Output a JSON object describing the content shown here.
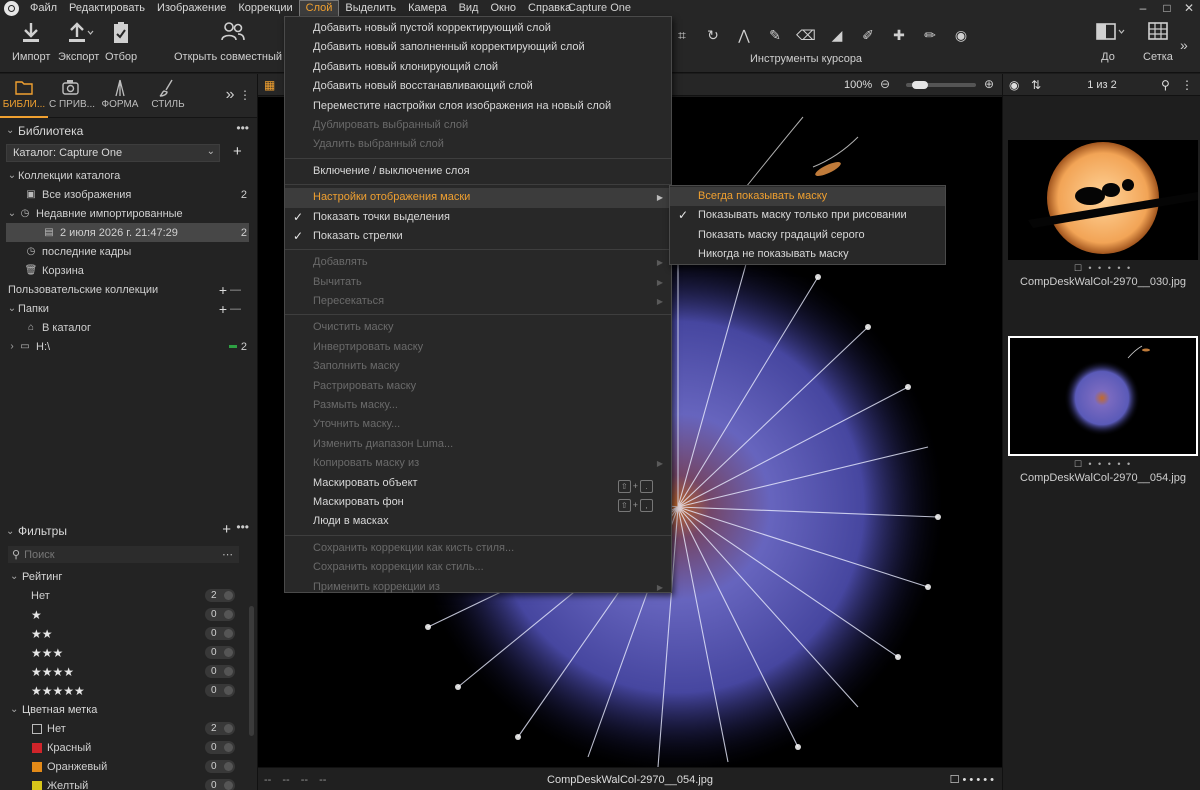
{
  "menubar": {
    "items": [
      "Файл",
      "Редактировать",
      "Изображение",
      "Коррекции",
      "Слой",
      "Выделить",
      "Камера",
      "Вид",
      "Окно",
      "Справка"
    ],
    "window_title": "Capture One",
    "active_item": "Слой"
  },
  "toolbar": {
    "import": "Импорт",
    "export": "Экспорт",
    "select": "Отбор",
    "open_shared": "Открыть совместный д",
    "cursor_tools": "Инструменты курсора",
    "before": "До",
    "grid": "Сетка"
  },
  "left": {
    "tabs": [
      "БИБЛИ...",
      "С ПРИВ...",
      "ФОРМА",
      "СТИЛЬ"
    ],
    "library_title": "Библиотека",
    "catalog": "Каталог: Capture One",
    "catalog_collections": "Коллекции каталога",
    "all_images": "Все изображения",
    "all_images_count": "2",
    "recent_imports": "Недавние импортированные",
    "import_date": "2 июля 2026 г. 21:47:29",
    "import_date_count": "2",
    "recent_frames": "последние кадры",
    "trash": "Корзина",
    "user_collections": "Пользовательские коллекции",
    "folders": "Папки",
    "in_catalog": "В каталог",
    "drive": "H:\\",
    "drive_count": "2"
  },
  "filters": {
    "title": "Фильтры",
    "search_placeholder": "Поиск",
    "rating_title": "Рейтинг",
    "rating_rows": [
      {
        "label": "Нет",
        "count": "2"
      },
      {
        "label": "★",
        "count": "0"
      },
      {
        "label": "★★",
        "count": "0"
      },
      {
        "label": "★★★",
        "count": "0"
      },
      {
        "label": "★★★★",
        "count": "0"
      },
      {
        "label": "★★★★★",
        "count": "0"
      }
    ],
    "color_title": "Цветная метка",
    "color_rows": [
      {
        "label": "Нет",
        "count": "2",
        "color": "none"
      },
      {
        "label": "Красный",
        "count": "0",
        "color": "#d0242a"
      },
      {
        "label": "Оранжевый",
        "count": "0",
        "color": "#e38a18"
      },
      {
        "label": "Желтый",
        "count": "0",
        "color": "#d8c61a"
      }
    ]
  },
  "viewer": {
    "zoom": "100%",
    "filename": "CompDeskWalCol-2970__054.jpg",
    "dashes": "-- -- -- --"
  },
  "browser": {
    "count": "1 из 2",
    "thumbs": [
      {
        "name": "CompDeskWalCol-2970__030.jpg"
      },
      {
        "name": "CompDeskWalCol-2970__054.jpg"
      }
    ]
  },
  "layer_menu": {
    "items": [
      {
        "label": "Добавить новый пустой корректирующий слой",
        "state": "normal"
      },
      {
        "label": "Добавить новый заполненный корректирующий слой",
        "state": "normal"
      },
      {
        "label": "Добавить новый клонирующий слой",
        "state": "normal"
      },
      {
        "label": "Добавить новый восстанавливающий слой",
        "state": "normal"
      },
      {
        "label": "Переместите настройки слоя изображения на новый слой",
        "state": "normal"
      },
      {
        "label": "Дублировать выбранный слой",
        "state": "disabled"
      },
      {
        "label": "Удалить выбранный слой",
        "state": "disabled"
      },
      {
        "label": "Включение / выключение слоя",
        "state": "normal"
      },
      {
        "label": "Настройки отображения маски",
        "state": "highlight"
      },
      {
        "label": "Показать точки выделения",
        "state": "checked"
      },
      {
        "label": "Показать стрелки",
        "state": "checked"
      },
      {
        "label": "Добавлять",
        "state": "disabled"
      },
      {
        "label": "Вычитать",
        "state": "disabled"
      },
      {
        "label": "Пересекаться",
        "state": "disabled"
      },
      {
        "label": "Очистить маску",
        "state": "disabled"
      },
      {
        "label": "Инвертировать маску",
        "state": "disabled"
      },
      {
        "label": "Заполнить маску",
        "state": "disabled"
      },
      {
        "label": "Растрировать маску",
        "state": "disabled"
      },
      {
        "label": "Размыть маску...",
        "state": "disabled"
      },
      {
        "label": "Уточнить маску...",
        "state": "disabled"
      },
      {
        "label": "Изменить диапазон Luma...",
        "state": "disabled"
      },
      {
        "label": "Копировать маску из",
        "state": "disabled"
      },
      {
        "label": "Маскировать объект",
        "state": "normal"
      },
      {
        "label": "Маскировать фон",
        "state": "normal"
      },
      {
        "label": "Люди в масках",
        "state": "normal"
      },
      {
        "label": "Сохранить коррекции как кисть стиля...",
        "state": "disabled"
      },
      {
        "label": "Сохранить коррекции как стиль...",
        "state": "disabled"
      },
      {
        "label": "Применить коррекции из",
        "state": "disabled"
      }
    ]
  },
  "mask_submenu": {
    "items": [
      {
        "label": "Всегда показывать маску",
        "state": "highlight"
      },
      {
        "label": "Показывать маску только при рисовании",
        "state": "checked"
      },
      {
        "label": "Показать маску градаций серого",
        "state": "normal"
      },
      {
        "label": "Никогда не показывать маску",
        "state": "normal"
      }
    ]
  },
  "colors": {
    "accent": "#f0a030",
    "menu_bg": "#282828",
    "panel_bg": "#232323"
  }
}
